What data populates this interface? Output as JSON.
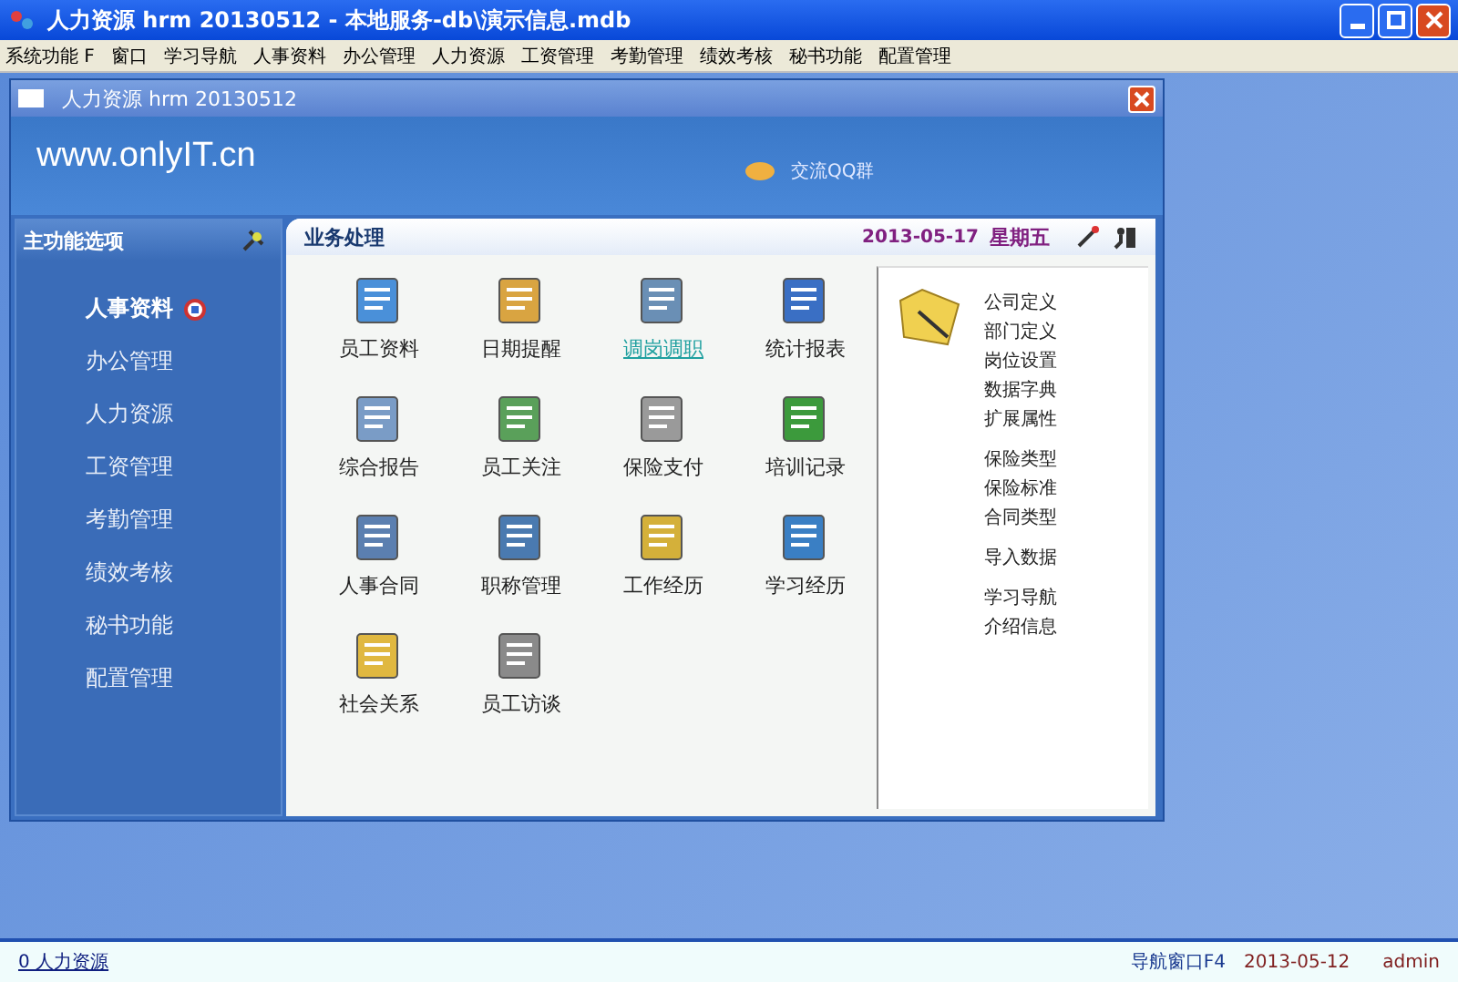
{
  "window": {
    "title": "人力资源 hrm 20130512 - 本地服务-db\\演示信息.mdb"
  },
  "menu": [
    "系统功能 F",
    "窗口",
    "学习导航",
    "人事资料",
    "办公管理",
    "人力资源",
    "工资管理",
    "考勤管理",
    "绩效考核",
    "秘书功能",
    "配置管理"
  ],
  "child_window": {
    "title": "人力资源 hrm 20130512",
    "site": "www.onlyIT.cn",
    "qq_link": "交流QQ群"
  },
  "sidebar": {
    "title": "主功能选项",
    "items": [
      {
        "label": "人事资料",
        "selected": true
      },
      {
        "label": "办公管理",
        "selected": false
      },
      {
        "label": "人力资源",
        "selected": false
      },
      {
        "label": "工资管理",
        "selected": false
      },
      {
        "label": "考勤管理",
        "selected": false
      },
      {
        "label": "绩效考核",
        "selected": false
      },
      {
        "label": "秘书功能",
        "selected": false
      },
      {
        "label": "配置管理",
        "selected": false
      }
    ]
  },
  "panel": {
    "title": "业务处理",
    "date": "2013-05-17",
    "weekday": "星期五",
    "tiles": [
      {
        "label": "员工资料",
        "selected": false
      },
      {
        "label": "日期提醒",
        "selected": false
      },
      {
        "label": "调岗调职",
        "selected": true
      },
      {
        "label": "统计报表",
        "selected": false
      },
      {
        "label": "综合报告",
        "selected": false
      },
      {
        "label": "员工关注",
        "selected": false
      },
      {
        "label": "保险支付",
        "selected": false
      },
      {
        "label": "培训记录",
        "selected": false
      },
      {
        "label": "人事合同",
        "selected": false
      },
      {
        "label": "职称管理",
        "selected": false
      },
      {
        "label": "工作经历",
        "selected": false
      },
      {
        "label": "学习经历",
        "selected": false
      },
      {
        "label": "社会关系",
        "selected": false
      },
      {
        "label": "员工访谈",
        "selected": false
      }
    ],
    "settings_groups": [
      [
        "公司定义",
        "部门定义",
        "岗位设置",
        "数据字典",
        "扩展属性"
      ],
      [
        "保险类型",
        "保险标准",
        "合同类型"
      ],
      [
        "导入数据"
      ],
      [
        "学习导航",
        "介绍信息"
      ]
    ]
  },
  "status_bar": {
    "left": "0 人力资源",
    "nav": "导航窗口F4",
    "date": "2013-05-12",
    "user": "admin"
  }
}
